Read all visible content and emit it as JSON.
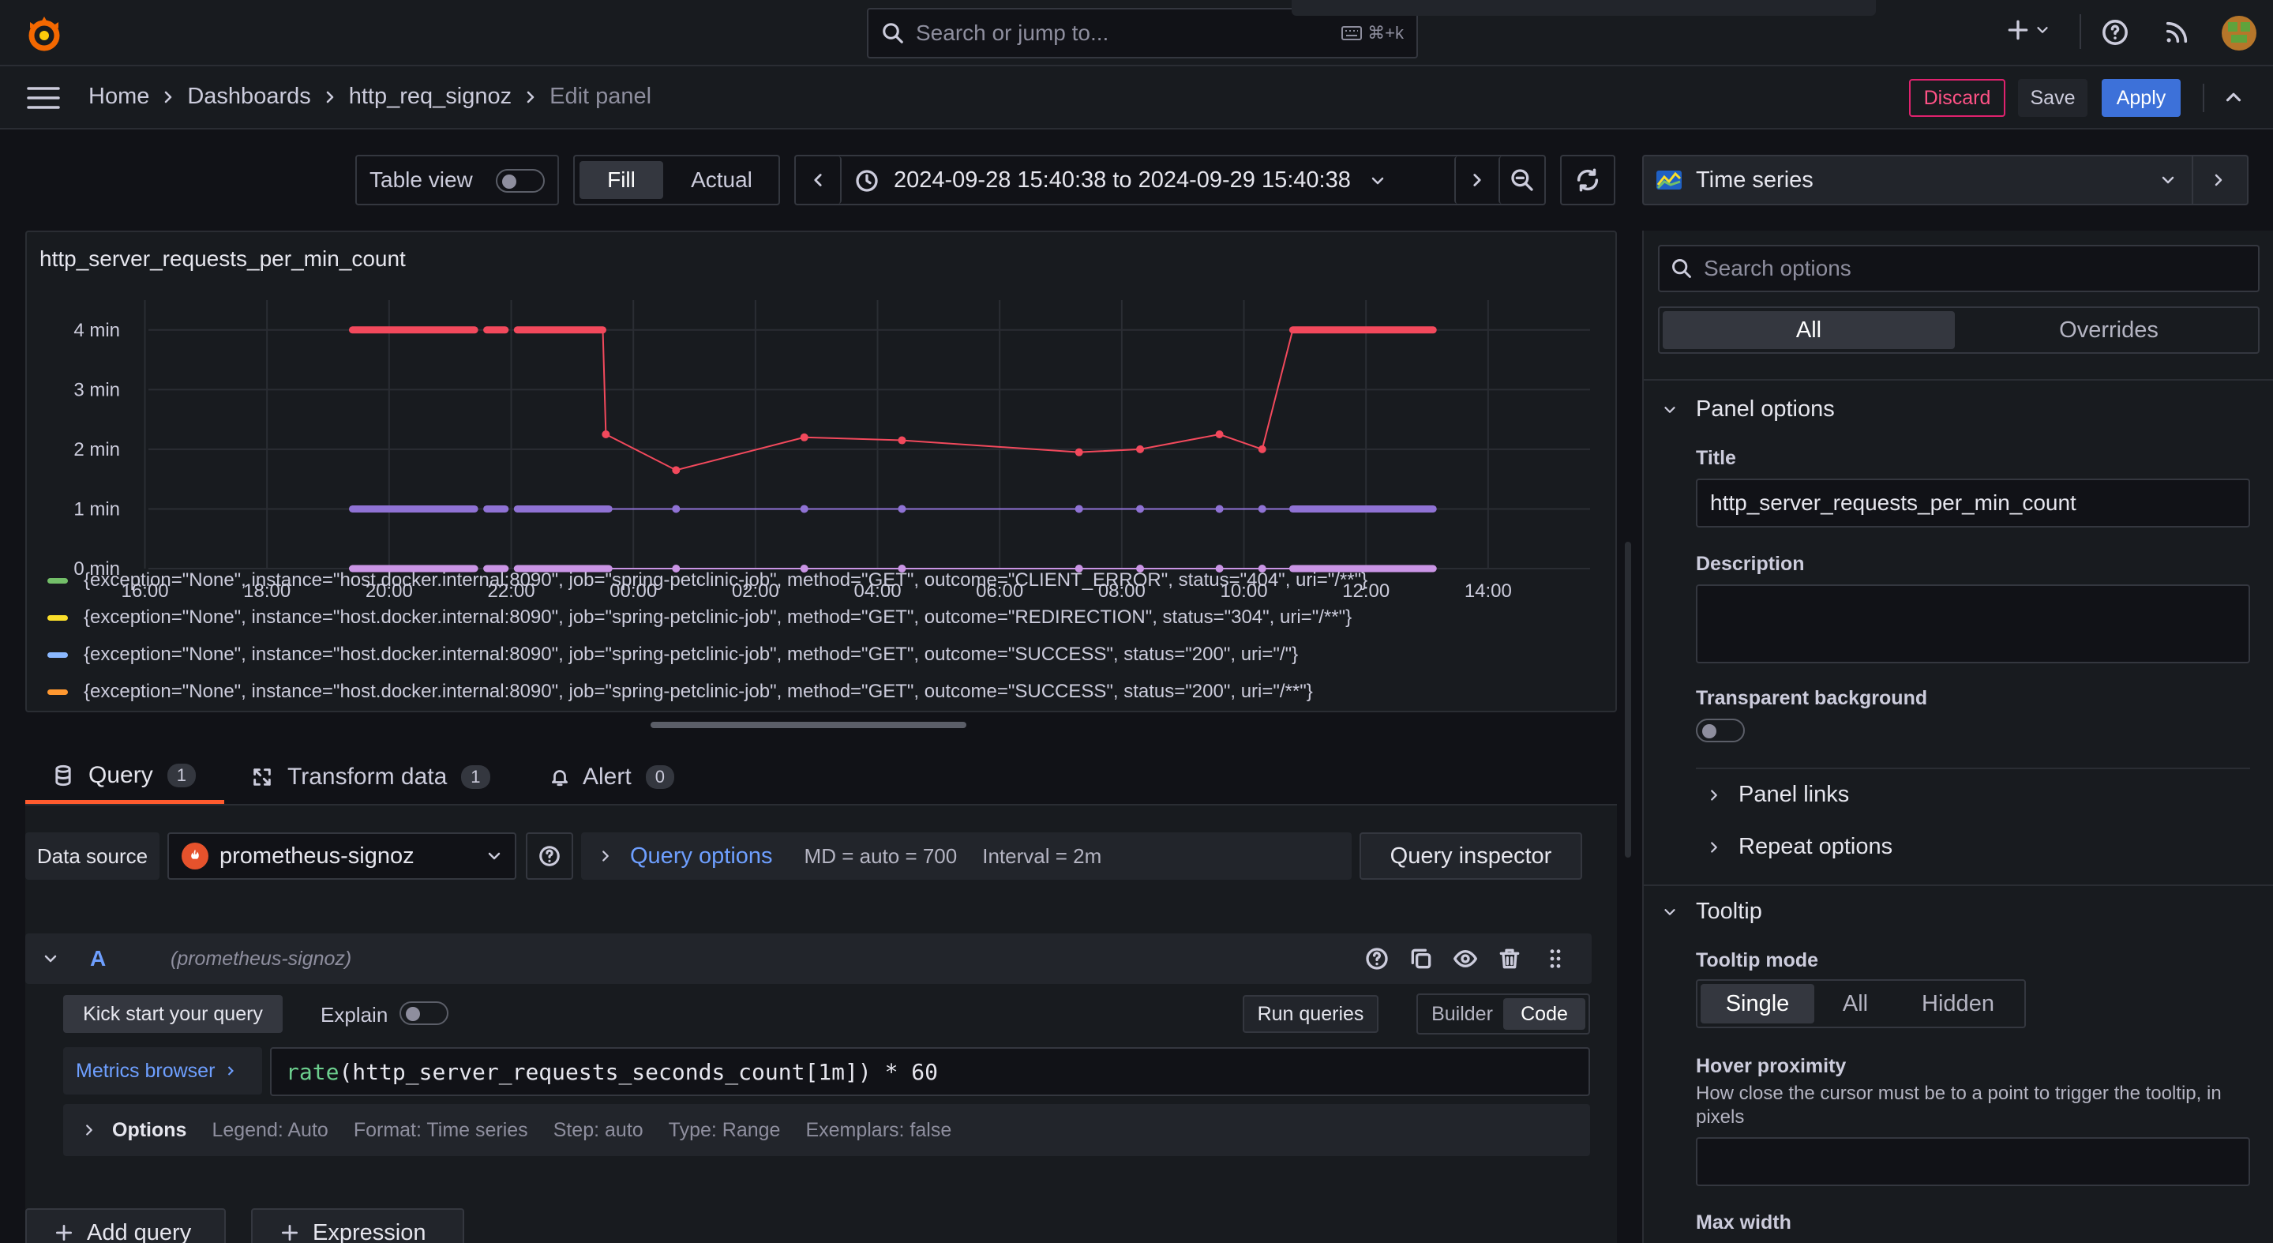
{
  "topbar": {
    "search_placeholder": "Search or jump to...",
    "shortcut": "⌘+k"
  },
  "breadcrumb": {
    "home": "Home",
    "dashboards": "Dashboards",
    "dashboard": "http_req_signoz",
    "current": "Edit panel"
  },
  "actions": {
    "discard": "Discard",
    "save": "Save",
    "apply": "Apply"
  },
  "toolbar": {
    "table_view": "Table view",
    "fill": "Fill",
    "actual": "Actual",
    "time_range": "2024-09-28 15:40:38 to 2024-09-29 15:40:38"
  },
  "viz_picker": {
    "label": "Time series"
  },
  "chart_data": {
    "type": "line",
    "title": "http_server_requests_per_min_count",
    "x_ticks": [
      "16:00",
      "18:00",
      "20:00",
      "22:00",
      "00:00",
      "02:00",
      "04:00",
      "06:00",
      "08:00",
      "10:00",
      "12:00",
      "14:00"
    ],
    "y_ticks": [
      "0 min",
      "1 min",
      "2 min",
      "3 min",
      "4 min"
    ],
    "ylim": [
      0,
      4.5
    ],
    "xlim_hours": [
      15.67,
      39.67
    ],
    "grid": true,
    "legend_position": "bottom",
    "series": [
      {
        "color": "#f2495c",
        "segments": [
          {
            "x": [
              19.4,
              20.2,
              21.0,
              21.4
            ],
            "y": [
              4,
              4,
              4,
              4
            ]
          },
          {
            "x": [
              21.6,
              21.9
            ],
            "y": [
              4,
              4
            ]
          },
          {
            "x": [
              22.1,
              22.6,
              23.0,
              23.5
            ],
            "y": [
              4,
              4,
              4,
              4
            ]
          }
        ],
        "line": {
          "x": [
            23.5,
            23.55,
            24.7,
            26.8,
            28.4,
            31.3,
            32.3,
            33.6,
            34.3,
            34.8
          ],
          "y": [
            4,
            2.25,
            1.65,
            2.2,
            2.15,
            1.95,
            2.0,
            2.25,
            2.0,
            4
          ]
        },
        "tail": {
          "x": [
            34.8,
            37.1
          ],
          "y": [
            4,
            4
          ]
        }
      },
      {
        "color": "#8f72d4",
        "segments": [
          {
            "x": [
              19.4,
              21.4
            ],
            "y": [
              1,
              1
            ]
          },
          {
            "x": [
              21.6,
              21.9
            ],
            "y": [
              1,
              1
            ]
          },
          {
            "x": [
              22.1,
              23.6
            ],
            "y": [
              1,
              1
            ]
          }
        ],
        "line": {
          "x": [
            23.6,
            24.7,
            26.8,
            28.4,
            31.3,
            32.3,
            33.6,
            34.3,
            34.8
          ],
          "y": [
            1,
            1,
            1,
            1,
            1,
            1,
            1,
            1,
            1
          ]
        },
        "tail": {
          "x": [
            34.8,
            37.1
          ],
          "y": [
            1,
            1
          ]
        }
      },
      {
        "color": "#ca95e5",
        "segments": [
          {
            "x": [
              19.4,
              21.4
            ],
            "y": [
              0,
              0
            ]
          },
          {
            "x": [
              21.6,
              21.9
            ],
            "y": [
              0,
              0
            ]
          },
          {
            "x": [
              22.1,
              23.6
            ],
            "y": [
              0,
              0
            ]
          }
        ],
        "line": {
          "x": [
            23.6,
            24.7,
            26.8,
            28.4,
            31.3,
            32.3,
            33.6,
            34.3,
            34.8
          ],
          "y": [
            0,
            0,
            0,
            0,
            0,
            0,
            0,
            0,
            0
          ]
        },
        "tail": {
          "x": [
            34.8,
            37.1
          ],
          "y": [
            0,
            0
          ]
        }
      }
    ],
    "legend": [
      {
        "color": "#73bf69",
        "label": "{exception=\"None\", instance=\"host.docker.internal:8090\", job=\"spring-petclinic-job\", method=\"GET\", outcome=\"CLIENT_ERROR\", status=\"404\", uri=\"/**\"}"
      },
      {
        "color": "#fade2a",
        "label": "{exception=\"None\", instance=\"host.docker.internal:8090\", job=\"spring-petclinic-job\", method=\"GET\", outcome=\"REDIRECTION\", status=\"304\", uri=\"/**\"}"
      },
      {
        "color": "#8ab8ff",
        "label": "{exception=\"None\", instance=\"host.docker.internal:8090\", job=\"spring-petclinic-job\", method=\"GET\", outcome=\"SUCCESS\", status=\"200\", uri=\"/\"}"
      },
      {
        "color": "#ff9830",
        "label": "{exception=\"None\", instance=\"host.docker.internal:8090\", job=\"spring-petclinic-job\", method=\"GET\", outcome=\"SUCCESS\", status=\"200\", uri=\"/**\"}"
      }
    ]
  },
  "tabs": [
    {
      "label": "Query",
      "count": "1"
    },
    {
      "label": "Transform data",
      "count": "1"
    },
    {
      "label": "Alert",
      "count": "0"
    }
  ],
  "query": {
    "datasource_label": "Data source",
    "datasource": "prometheus-signoz",
    "options_label": "Query options",
    "md": "MD = auto = 700",
    "interval": "Interval = 2m",
    "inspector": "Query inspector",
    "row_letter": "A",
    "row_source": "(prometheus-signoz)",
    "kick_start": "Kick start your query",
    "explain": "Explain",
    "run": "Run queries",
    "builder": "Builder",
    "code": "Code",
    "metrics_browser": "Metrics browser",
    "expr_fn": "rate",
    "expr_rest": "(http_server_requests_seconds_count[1m]) * 60",
    "options": "Options",
    "legend": "Legend: Auto",
    "format": "Format: Time series",
    "step": "Step: auto",
    "qtype": "Type: Range",
    "exemplars": "Exemplars: false",
    "add_query": "Add query",
    "expression": "Expression"
  },
  "options_pane": {
    "search_placeholder": "Search options",
    "tab_all": "All",
    "tab_overrides": "Overrides",
    "panel_options": "Panel options",
    "title_label": "Title",
    "title_value": "http_server_requests_per_min_count",
    "description_label": "Description",
    "transparent_label": "Transparent background",
    "panel_links": "Panel links",
    "repeat_options": "Repeat options",
    "tooltip": "Tooltip",
    "tooltip_mode_label": "Tooltip mode",
    "mode_single": "Single",
    "mode_all": "All",
    "mode_hidden": "Hidden",
    "hover_label": "Hover proximity",
    "hover_desc": "How close the cursor must be to a point to trigger the tooltip, in pixels",
    "max_width": "Max width"
  }
}
